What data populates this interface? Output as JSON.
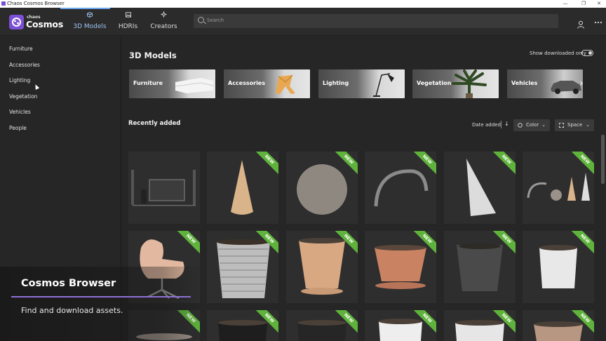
{
  "window": {
    "title": "Chaos Cosmos Browser",
    "controls": [
      "—",
      "❐",
      "✕"
    ]
  },
  "brand": {
    "small": "chaos",
    "name": "Cosmos"
  },
  "nav": [
    {
      "label": "3D Models",
      "icon": "cube-icon",
      "active": true
    },
    {
      "label": "HDRIs",
      "icon": "image-icon",
      "active": false
    },
    {
      "label": "Creators",
      "icon": "sparkle-icon",
      "active": false
    }
  ],
  "search": {
    "placeholder": "Search"
  },
  "sidebar": {
    "items": [
      {
        "label": "Furniture"
      },
      {
        "label": "Accessories"
      },
      {
        "label": "Lighting"
      },
      {
        "label": "Vegetation"
      },
      {
        "label": "Vehicles"
      },
      {
        "label": "People"
      }
    ]
  },
  "main": {
    "title": "3D Models",
    "toggle_label": "Show downloaded only",
    "categories": [
      {
        "label": "Furniture"
      },
      {
        "label": "Accessories"
      },
      {
        "label": "Lighting"
      },
      {
        "label": "Vegetation"
      },
      {
        "label": "Vehicles"
      }
    ],
    "recent_title": "Recently added",
    "sort_label": "Date added",
    "sort_dir": "↓",
    "filters": {
      "color": "Color",
      "space": "Space"
    },
    "badge": "NEW"
  },
  "overlay": {
    "title": "Cosmos Browser",
    "subtitle": "Find and download assets."
  },
  "colors": {
    "accent": "#6aa6ef",
    "brand": "#7b4fd6",
    "new_badge": "#5fb33c",
    "overlay_line": "#8e6fd6"
  }
}
